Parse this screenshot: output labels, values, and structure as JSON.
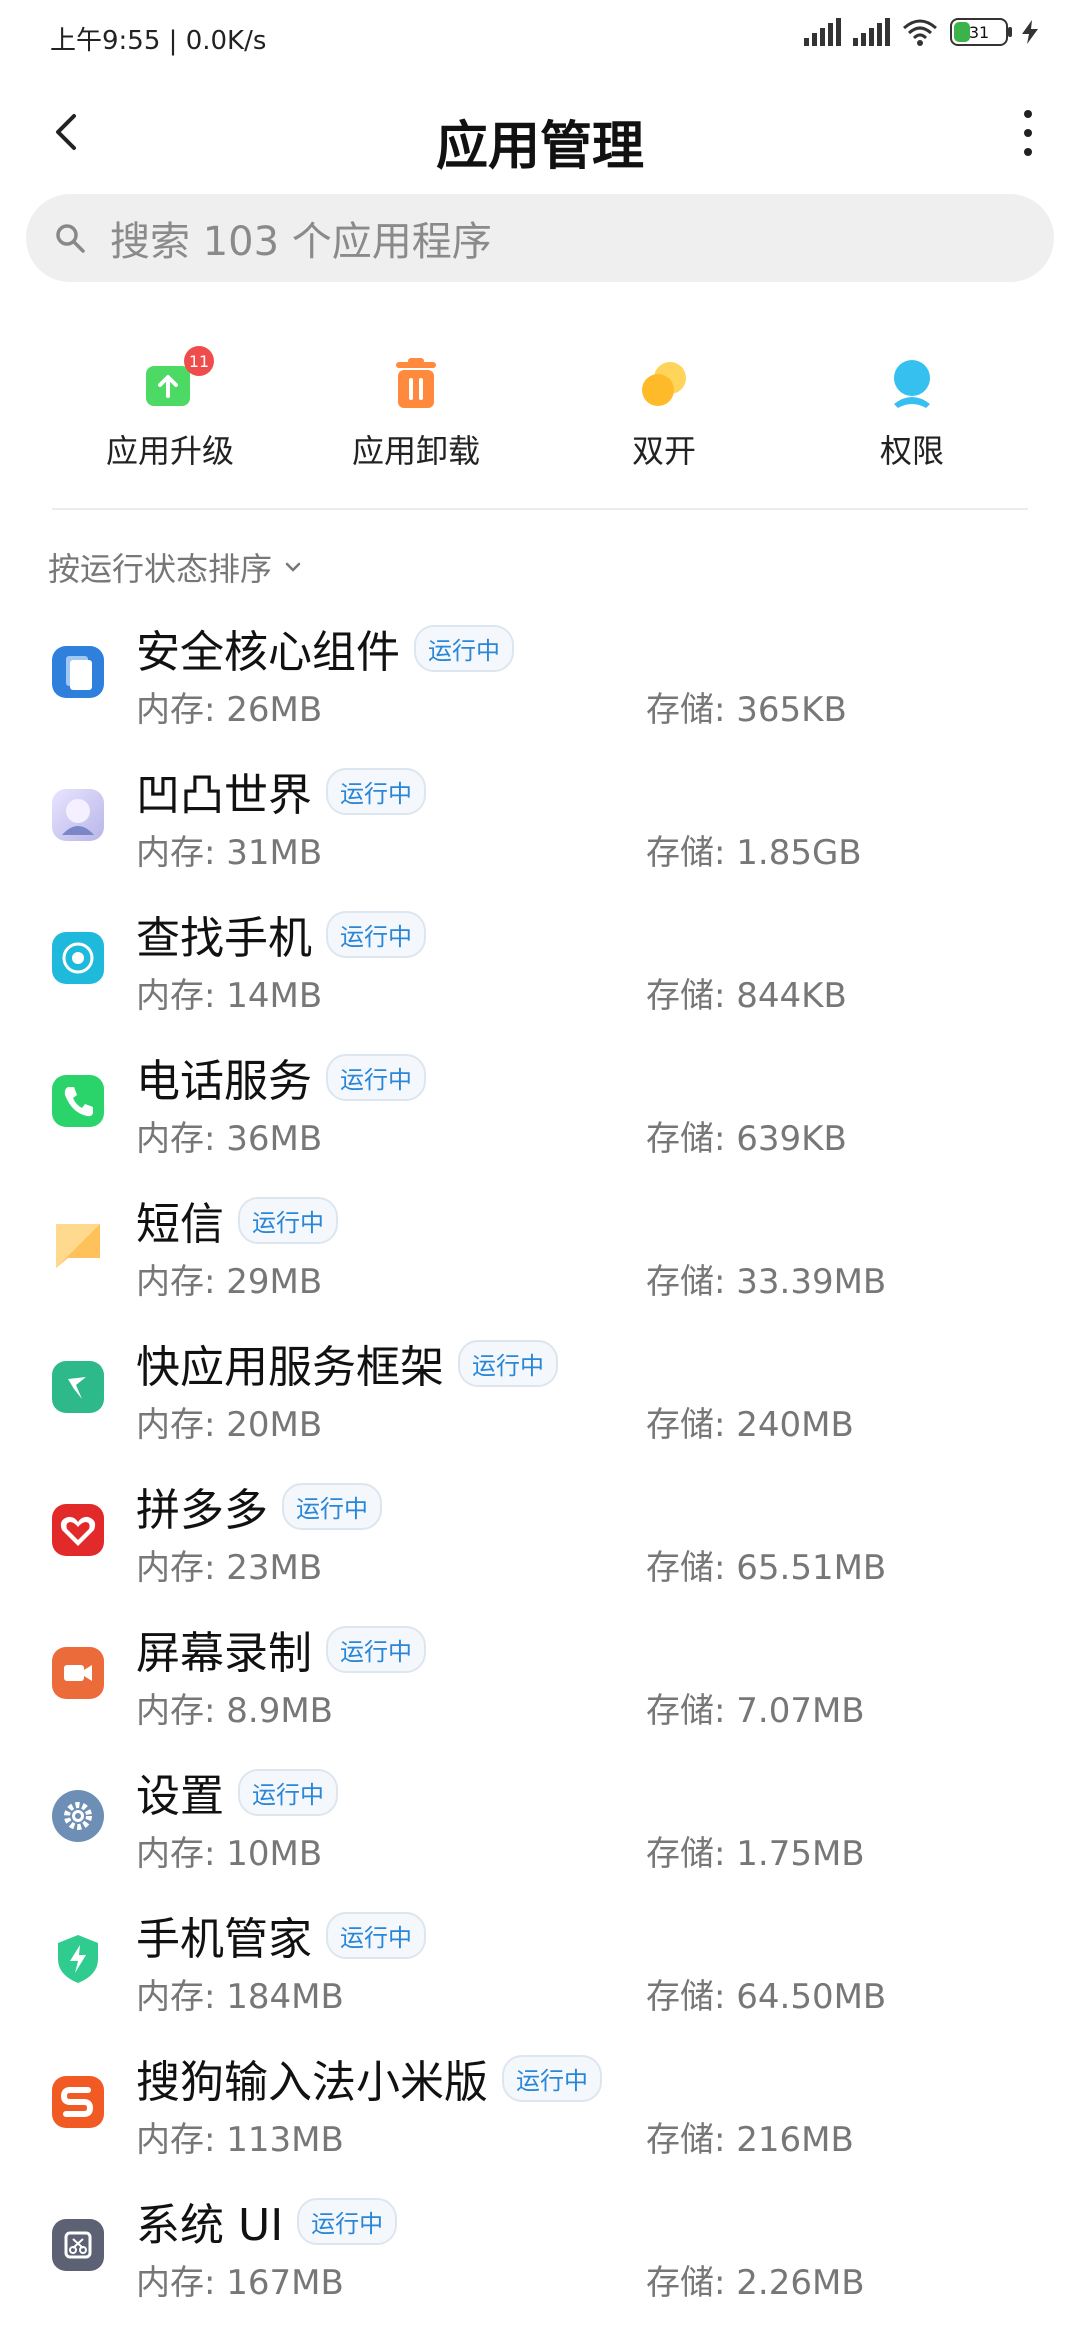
{
  "status_bar": {
    "time": "上午9:55",
    "net_speed": "0.0K/s",
    "battery": "31"
  },
  "header": {
    "title": "应用管理"
  },
  "search": {
    "placeholder": "搜索 103 个应用程序"
  },
  "quick_actions": [
    {
      "label": "应用升级",
      "badge": "11",
      "icon": "upgrade-icon",
      "color": "#4cd964"
    },
    {
      "label": "应用卸载",
      "icon": "trash-icon",
      "color": "#ff8a3d"
    },
    {
      "label": "双开",
      "icon": "dual-app-icon",
      "color": "#ffc12e"
    },
    {
      "label": "权限",
      "icon": "permission-icon",
      "color": "#35c0f0"
    }
  ],
  "sort": {
    "label": "按运行状态排序"
  },
  "running_label": "运行中",
  "apps": [
    {
      "name": "安全核心组件",
      "memory": "内存: 26MB",
      "storage": "存储: 365KB",
      "icon": "security-core-icon",
      "color": "#2f7fdc"
    },
    {
      "name": "凹凸世界",
      "memory": "内存: 31MB",
      "storage": "存储: 1.85GB",
      "icon": "aotu-world-icon",
      "color": "#c9c9f0"
    },
    {
      "name": "查找手机",
      "memory": "内存: 14MB",
      "storage": "存储: 844KB",
      "icon": "find-phone-icon",
      "color": "#1fbadb"
    },
    {
      "name": "电话服务",
      "memory": "内存: 36MB",
      "storage": "存储: 639KB",
      "icon": "phone-service-icon",
      "color": "#2bd46a"
    },
    {
      "name": "短信",
      "memory": "内存: 29MB",
      "storage": "存储: 33.39MB",
      "icon": "sms-icon",
      "color": "#ffc25a"
    },
    {
      "name": "快应用服务框架",
      "memory": "内存: 20MB",
      "storage": "存储: 240MB",
      "icon": "quick-app-icon",
      "color": "#2eb98a"
    },
    {
      "name": "拼多多",
      "memory": "内存: 23MB",
      "storage": "存储: 65.51MB",
      "icon": "pinduoduo-icon",
      "color": "#e22a2a"
    },
    {
      "name": "屏幕录制",
      "memory": "内存: 8.9MB",
      "storage": "存储: 7.07MB",
      "icon": "screen-record-icon",
      "color": "#ec6b3a"
    },
    {
      "name": "设置",
      "memory": "内存: 10MB",
      "storage": "存储: 1.75MB",
      "icon": "settings-gear-icon",
      "color": "#6d8fb5"
    },
    {
      "name": "手机管家",
      "memory": "内存: 184MB",
      "storage": "存储: 64.50MB",
      "icon": "phone-manager-icon",
      "color": "#2fcb8f"
    },
    {
      "name": "搜狗输入法小米版",
      "memory": "内存: 113MB",
      "storage": "存储: 216MB",
      "icon": "sogou-input-icon",
      "color": "#f25a24"
    },
    {
      "name": "系统 UI",
      "memory": "内存: 167MB",
      "storage": "存储: 2.26MB",
      "icon": "system-ui-icon",
      "color": "#5c6173"
    }
  ]
}
